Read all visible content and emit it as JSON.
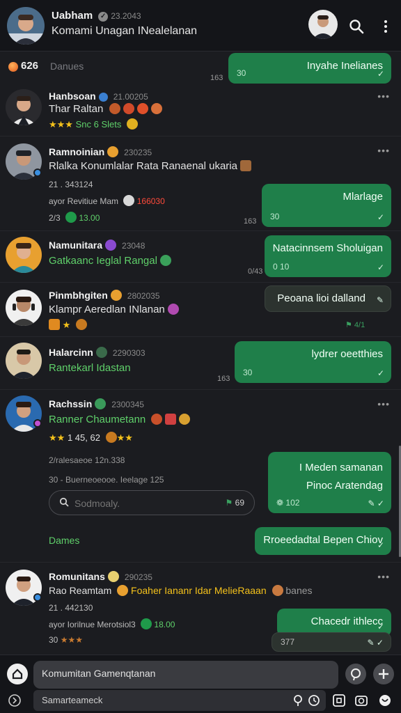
{
  "header": {
    "title": "Uabham",
    "stamp": "23.2043",
    "subtitle": "Komami Unagan INealelanan"
  },
  "strip": {
    "count": "626",
    "label": "Danues"
  },
  "posts": [
    {
      "name": "Hanbsoan",
      "stamp": "21.00205",
      "text": "Thar Raltan",
      "meta": "Snc 6 Slets",
      "bubble": {
        "text": "Inyahe Inelianes",
        "meta": "30",
        "side": "163"
      }
    },
    {
      "name": "Ramnoinian",
      "stamp": "230235",
      "text": "Rlalka Konumlalar Rata Ranaenal ukaria",
      "meta": "21 . 343124",
      "meta2": "ayor Revitiue Mam",
      "meta2_red": "166030",
      "meta3": "2/3",
      "meta3_green": "13.00",
      "bubble": {
        "text": "Mlarlage",
        "meta": "30",
        "side": "163"
      }
    },
    {
      "name": "Namunitara",
      "stamp": "23048",
      "text": "Gatkaanc Ieglal Rangal",
      "bubble": {
        "text": "Natacinnsem Sholuigan",
        "meta": "0 10",
        "side": "0/43"
      }
    },
    {
      "name": "Pinmbhgiten",
      "stamp": "2802035",
      "text": "Klampr Aeredlan INlanan",
      "bubble": {
        "text": "Peoana lioi dalland",
        "side": "4/1"
      }
    },
    {
      "name": "Halarcinn",
      "stamp": "2290303",
      "text": "Rantekarl Idastan",
      "bubble": {
        "text": "lydrer oeetthies",
        "meta": "30",
        "side": "163"
      }
    },
    {
      "name": "Rachssin",
      "stamp": "2300345",
      "text": "Ranner Chaumetann",
      "meta": "1 45, 62",
      "meta2": "2/ralesaeoe 12n.338",
      "meta3": "30 - Buerneoeooe. Ieelage 125",
      "search_placeholder": "Sodmoaly.",
      "search_right": "69",
      "label_green": "Dames",
      "bubble": {
        "text": "I Meden samanan Pinoc Aratendag",
        "meta": "102"
      },
      "bubble2": {
        "text": "Rroeedadtal Bepen Chiov"
      }
    },
    {
      "name": "Romunitans",
      "stamp": "290235",
      "text": "Rao Reamtam",
      "text_yellow": "Foaher Iananr Idar MelieRaaan",
      "text_tail": "banes",
      "meta": "21 . 442130",
      "meta2": "ayor Iorilnue Merotsiol3",
      "meta2_green": "18.00",
      "meta3": "30",
      "bubble": {
        "text": "Chacedr ithlecc",
        "meta": "377"
      }
    }
  ],
  "composer": {
    "input_value": "Komumitan Gamenqtanan",
    "sub_text": "Samarteameck"
  },
  "colors": {
    "accent_green": "#1f7f4a",
    "text_green": "#5fd06a",
    "red": "#ff4a3a"
  }
}
